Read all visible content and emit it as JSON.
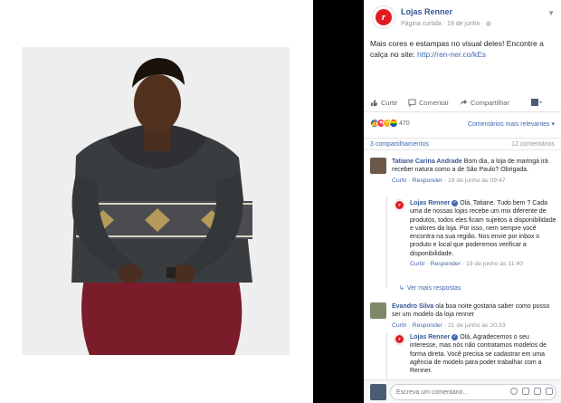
{
  "post": {
    "page_name": "Lojas Renner",
    "meta": "Página curtida · 19 de junho ·",
    "text": "Mais cores e estampas no visual deles! Encontre a calça no site: ",
    "link": "http://ren-ner.co/kEs",
    "logo_letter": "r"
  },
  "actions": {
    "like": "Curtir",
    "comment": "Comentar",
    "share": "Compartilhar"
  },
  "reactions": {
    "count": "470",
    "sort": "Comentários mais relevantes ▾"
  },
  "stats": {
    "shares": "3 compartilhamentos",
    "comments": "12 comentários"
  },
  "comments": [
    {
      "name": "Tatiane Carina Andrade",
      "text": "Bom dia, a loja de maringá irá receber natura como a de São Paulo? Obrigada.",
      "like": "Curtir",
      "reply": "Responder",
      "time": "19 de junho às 09:47",
      "reply_item": {
        "name": "Lojas Renner",
        "text": "Olá, Tatiane. Tudo bem ? Cada uma de nossas lojas recebe um mix diferente de produtos, todos eles ficam sujeitos à disponibilidade e valores da loja. Por isso, nem sempre você encontra na sua região. Nos envie por inbox o produto e local que poderemos verificar a disponibilidade.",
        "like": "Curtir",
        "reply": "Responder",
        "time": "19 de junho às 11:40"
      },
      "more_replies": "Ver mais respostas"
    },
    {
      "name": "Evandro Silva",
      "text": "ola boa noite gostaria saber como posso ser um modelo da loja renner",
      "like": "Curtir",
      "reply": "Responder",
      "time": "21 de junho às 20:33",
      "reply_item": {
        "name": "Lojas Renner",
        "text": "Olá, Agradecemos o seu interesse, mas nós não contratamos modelos de forma direta. Você precisa se cadastrar em uma agência de modelo para poder trabalhar com a Renner."
      }
    }
  ],
  "composer": {
    "placeholder": "Escreva um comentário..."
  },
  "colors": {
    "brand": "#e11b22",
    "link": "#4267b2",
    "name": "#365899"
  },
  "icons": [
    "chevron-down-icon",
    "like-icon",
    "comment-icon",
    "share-icon",
    "verified-icon",
    "camera-icon",
    "emoji-icon",
    "gif-icon",
    "sticker-icon"
  ]
}
